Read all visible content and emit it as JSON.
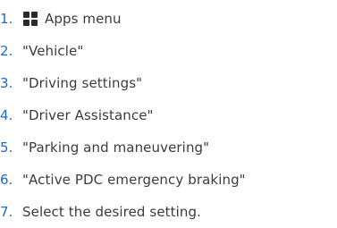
{
  "steps": [
    {
      "number": "1.",
      "text": "Apps menu",
      "icon": "apps-grid-icon"
    },
    {
      "number": "2.",
      "text": "\"Vehicle\""
    },
    {
      "number": "3.",
      "text": "\"Driving settings\""
    },
    {
      "number": "4.",
      "text": "\"Driver Assistance\""
    },
    {
      "number": "5.",
      "text": "\"Parking and maneuvering\""
    },
    {
      "number": "6.",
      "text": "\"Active PDC emergency braking\""
    },
    {
      "number": "7.",
      "text": "Select the desired setting."
    }
  ],
  "colors": {
    "number": "#1c69d4",
    "text": "#3c3c3c",
    "icon": "#2b2b2b"
  }
}
